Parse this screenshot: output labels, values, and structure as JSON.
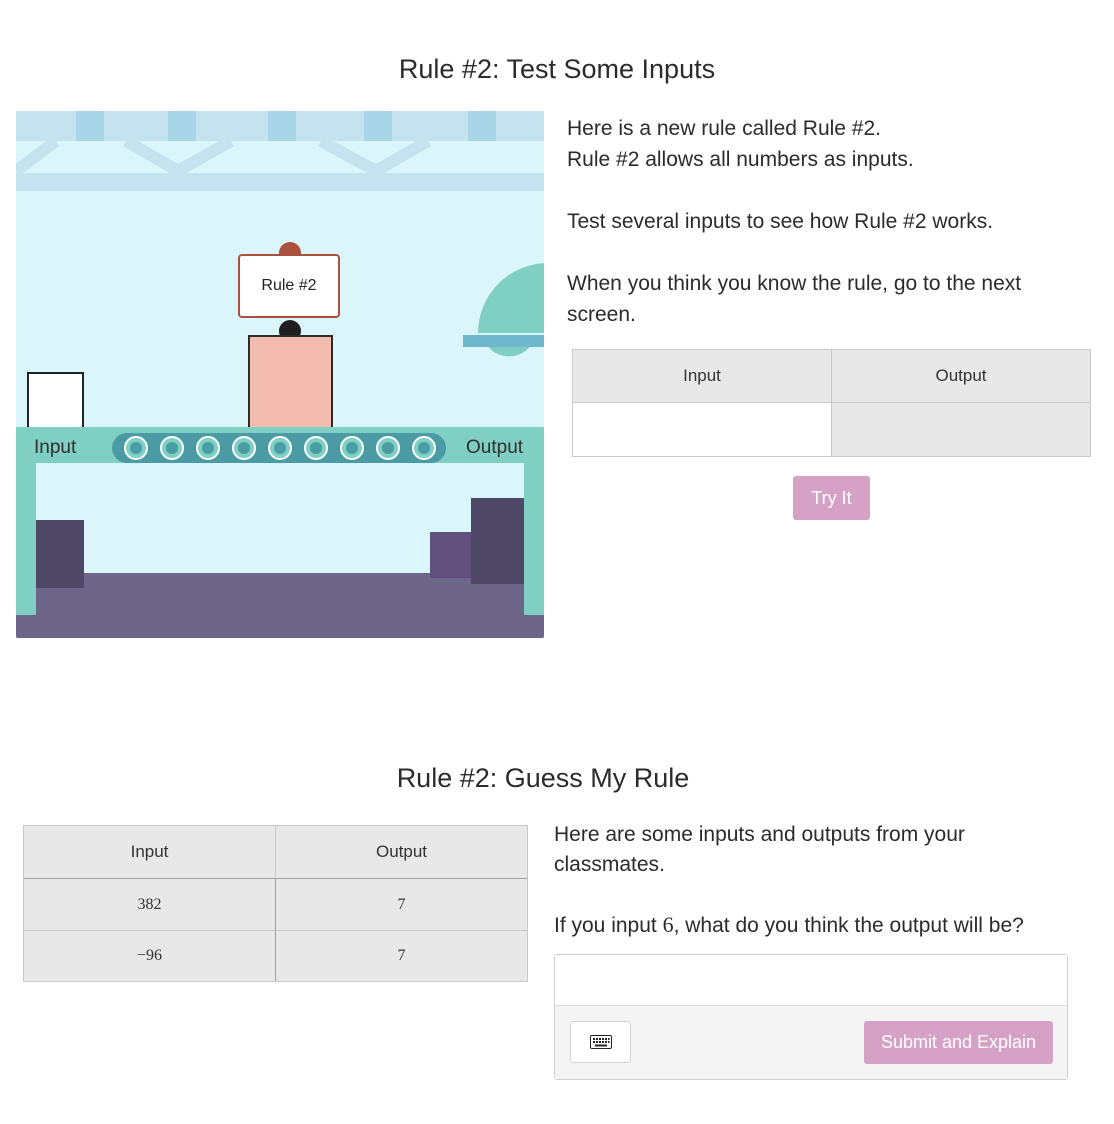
{
  "screen1": {
    "title": "Rule #2: Test Some Inputs",
    "machine_label": "Rule #2",
    "conveyor_input_label": "Input",
    "conveyor_output_label": "Output",
    "paragraphs": {
      "line1": "Here is a new rule called Rule #2.",
      "line2": "Rule #2 allows all numbers as inputs.",
      "line3": "Test several inputs to see how Rule #2 works.",
      "line4": "When you think you know the rule, go to the next screen."
    },
    "table": {
      "headers": [
        "Input",
        "Output"
      ],
      "input_value": "",
      "output_value": ""
    },
    "try_button": "Try It"
  },
  "screen2": {
    "title": "Rule #2: Guess My Rule",
    "table": {
      "headers": [
        "Input",
        "Output"
      ],
      "rows": [
        [
          "382",
          "7"
        ],
        [
          "−96",
          "7"
        ]
      ]
    },
    "intro": "Here are some inputs and outputs from your classmates.",
    "question_before": "If you input ",
    "question_value": "6",
    "question_after": ", what do you think the output will be?",
    "answer_value": "",
    "submit_button": "Submit and Explain",
    "keyboard_icon": "keyboard-icon"
  },
  "colors": {
    "accent_button": "#d5a2c6",
    "scene_sky": "#dbf6fb",
    "conveyor": "#7fcfc2",
    "machine_body": "#f4bcae",
    "floor": "#6d6689",
    "table_header": "#e8e8e8"
  }
}
